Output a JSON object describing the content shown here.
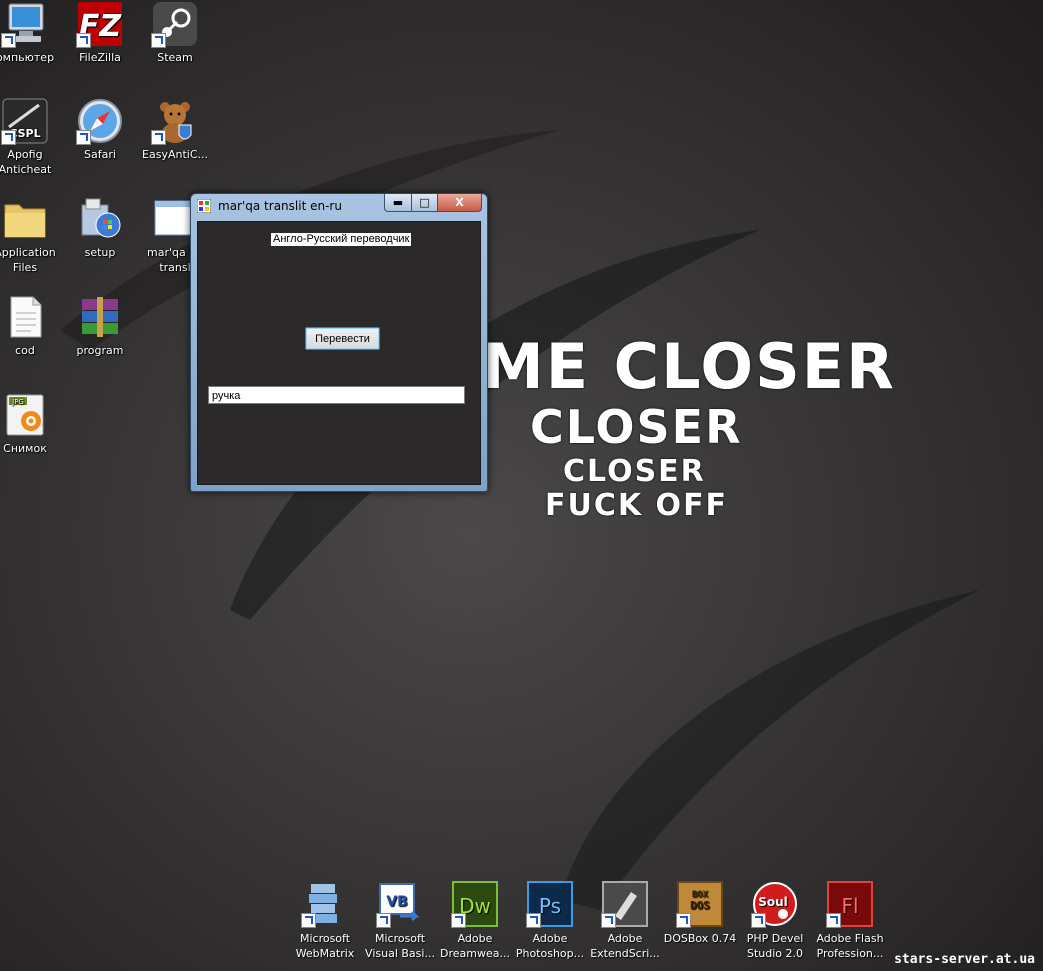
{
  "desktop": {
    "icons": [
      {
        "label": "омпьютер",
        "icon": "computer-icon"
      },
      {
        "label": "FileZilla",
        "icon": "filezilla-icon"
      },
      {
        "label": "Steam",
        "icon": "steam-icon"
      },
      {
        "label": "Apofig Anticheat",
        "icon": "cspl-icon"
      },
      {
        "label": "Safari",
        "icon": "safari-icon"
      },
      {
        "label": "EasyAntiC...",
        "icon": "teddy-bear-icon"
      },
      {
        "label": "Application Files",
        "icon": "folder-icon"
      },
      {
        "label": "setup",
        "icon": "setup-icon"
      },
      {
        "label": "mar'qa en transl",
        "icon": "window-app-icon"
      },
      {
        "label": "cod",
        "icon": "text-file-icon"
      },
      {
        "label": "program",
        "icon": "winrar-icon"
      },
      {
        "label": "Снимок",
        "icon": "jpg-file-icon"
      }
    ],
    "icon_sublabels": {
      "cspl": "CSPL",
      "jpg": "JPG"
    }
  },
  "wallpaper": {
    "lines": [
      "ME CLOSER",
      "CLOSER",
      "CLOSER",
      "FUCK OFF"
    ]
  },
  "window": {
    "title": "mar'qa translit en-ru",
    "min_glyph": "▬",
    "max_glyph": "□",
    "close_glyph": "X",
    "header_label": "Англо-Русский переводчик",
    "translate_button": "Перевести",
    "input_value": "ручка"
  },
  "taskbar": {
    "items": [
      {
        "label1": "Microsoft",
        "label2": "WebMatrix",
        "icon": "webmatrix-icon"
      },
      {
        "label1": "Microsoft",
        "label2": "Visual Basi...",
        "icon": "visual-basic-icon"
      },
      {
        "label1": "Adobe",
        "label2": "Dreamwea...",
        "icon": "dreamweaver-icon"
      },
      {
        "label1": "Adobe",
        "label2": "Photoshop...",
        "icon": "photoshop-icon"
      },
      {
        "label1": "Adobe",
        "label2": "ExtendScri...",
        "icon": "extendscript-icon"
      },
      {
        "label1": "DOSBox 0.74",
        "label2": "",
        "icon": "dosbox-icon"
      },
      {
        "label1": "PHP Devel",
        "label2": "Studio 2.0",
        "icon": "php-devel-studio-icon"
      },
      {
        "label1": "Adobe Flash",
        "label2": "Profession...",
        "icon": "flash-icon"
      }
    ],
    "badge_text": {
      "vb": "VB",
      "dw": "Dw",
      "ps": "Ps",
      "dos": "DOS",
      "box": "BOX",
      "soul": "Soul",
      "fl": "Fl"
    }
  },
  "watermark": "stars-server.at.ua",
  "colors": {
    "wallpaper": "#3b3939",
    "window_frame": "#9bb6d6",
    "close_red": "#c75b43"
  }
}
